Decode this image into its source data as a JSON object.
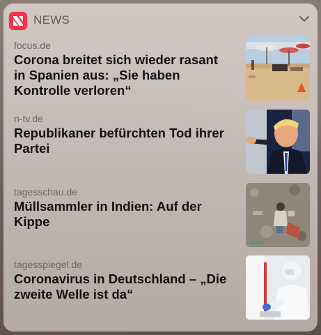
{
  "app": {
    "name": "NEWS",
    "icon": "apple-news-icon",
    "collapse_icon": "chevron-down-icon"
  },
  "articles": [
    {
      "source": "focus.de",
      "headline": "Corona breitet sich wieder rasant in Spanien aus: „Sie haben Kontrolle verloren“",
      "thumbnail": "beach-photo"
    },
    {
      "source": "n-tv.de",
      "headline": "Republikaner befürchten Tod ihrer Partei",
      "thumbnail": "politician-photo"
    },
    {
      "source": "tagesschau.de",
      "headline": "Müllsammler in Indien: Auf der Kippe",
      "thumbnail": "landfill-photo"
    },
    {
      "source": "tagesspiegel.de",
      "headline": "Coronavirus in Deutschland – „Die zweite Welle ist da“",
      "thumbnail": "lab-worker-photo"
    }
  ],
  "colors": {
    "news_red": "#f5334a",
    "source_text": "#6e6661",
    "headline_text": "#111111"
  }
}
